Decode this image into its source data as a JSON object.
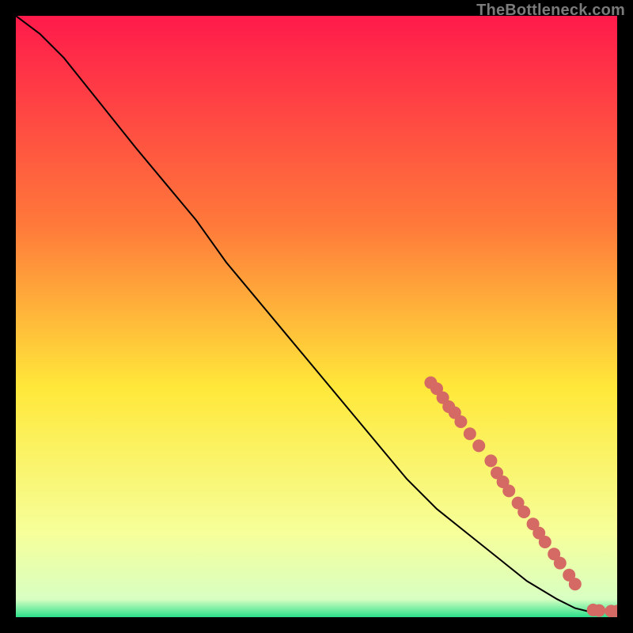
{
  "watermark": "TheBottleneck.com",
  "colors": {
    "gradient_top": "#ff1a4b",
    "gradient_mid1": "#ff7a3a",
    "gradient_mid2": "#ffe83a",
    "gradient_mid3": "#f6ff9a",
    "gradient_bottom": "#2be08a",
    "curve": "#000000",
    "marker": "#d46a63"
  },
  "chart_data": {
    "type": "line",
    "title": "",
    "xlabel": "",
    "ylabel": "",
    "xlim": [
      0,
      100
    ],
    "ylim": [
      0,
      100
    ],
    "grid": false,
    "curve": [
      {
        "x": 0,
        "y": 100
      },
      {
        "x": 4,
        "y": 97
      },
      {
        "x": 8,
        "y": 93
      },
      {
        "x": 12,
        "y": 88
      },
      {
        "x": 16,
        "y": 83
      },
      {
        "x": 20,
        "y": 78
      },
      {
        "x": 25,
        "y": 72
      },
      {
        "x": 30,
        "y": 66
      },
      {
        "x": 35,
        "y": 59
      },
      {
        "x": 40,
        "y": 53
      },
      {
        "x": 45,
        "y": 47
      },
      {
        "x": 50,
        "y": 41
      },
      {
        "x": 55,
        "y": 35
      },
      {
        "x": 60,
        "y": 29
      },
      {
        "x": 65,
        "y": 23
      },
      {
        "x": 70,
        "y": 18
      },
      {
        "x": 75,
        "y": 14
      },
      {
        "x": 80,
        "y": 10
      },
      {
        "x": 85,
        "y": 6
      },
      {
        "x": 90,
        "y": 3
      },
      {
        "x": 93,
        "y": 1.5
      },
      {
        "x": 95,
        "y": 1
      },
      {
        "x": 97,
        "y": 1
      },
      {
        "x": 100,
        "y": 1
      }
    ],
    "markers": [
      {
        "x": 69,
        "y": 39
      },
      {
        "x": 70,
        "y": 38
      },
      {
        "x": 71,
        "y": 36.5
      },
      {
        "x": 72,
        "y": 35
      },
      {
        "x": 73,
        "y": 34
      },
      {
        "x": 74,
        "y": 32.5
      },
      {
        "x": 75.5,
        "y": 30.5
      },
      {
        "x": 77,
        "y": 28.5
      },
      {
        "x": 79,
        "y": 26
      },
      {
        "x": 80,
        "y": 24
      },
      {
        "x": 81,
        "y": 22.5
      },
      {
        "x": 82,
        "y": 21
      },
      {
        "x": 83.5,
        "y": 19
      },
      {
        "x": 84.5,
        "y": 17.5
      },
      {
        "x": 86,
        "y": 15.5
      },
      {
        "x": 87,
        "y": 14
      },
      {
        "x": 88,
        "y": 12.5
      },
      {
        "x": 89.5,
        "y": 10.5
      },
      {
        "x": 90.5,
        "y": 9
      },
      {
        "x": 92,
        "y": 7
      },
      {
        "x": 93,
        "y": 5.5
      },
      {
        "x": 96,
        "y": 1.2
      },
      {
        "x": 97,
        "y": 1.1
      },
      {
        "x": 99,
        "y": 1
      },
      {
        "x": 100,
        "y": 1
      }
    ]
  }
}
